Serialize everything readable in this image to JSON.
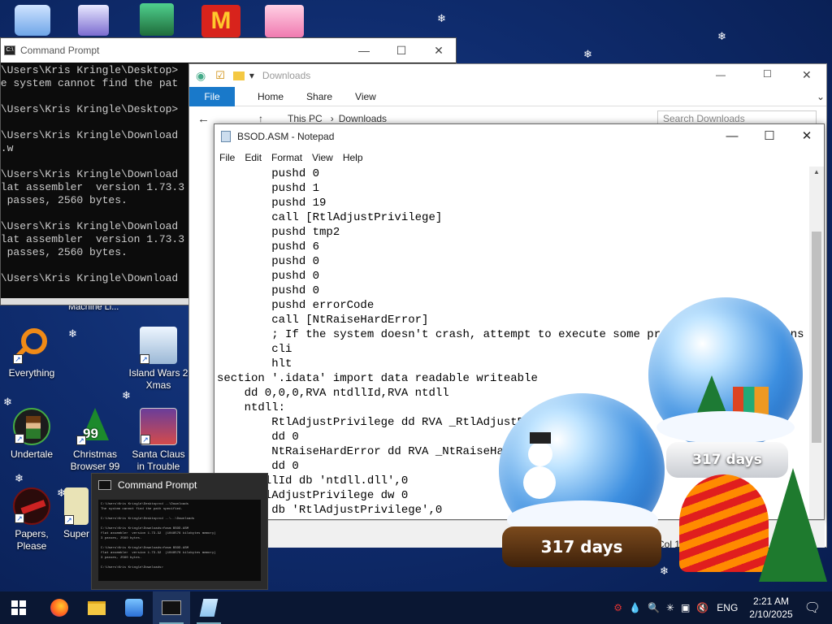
{
  "desktop": {
    "icons": [
      {
        "label": "Everything"
      },
      {
        "label": "Island Wars 2 Xmas"
      },
      {
        "label": "Undertale"
      },
      {
        "label": "Christmas Browser 99"
      },
      {
        "label": "Santa Claus in Trouble"
      },
      {
        "label": "Papers, Please"
      },
      {
        "label": "Super"
      },
      {
        "label": "Machine Li..."
      }
    ]
  },
  "cmd": {
    "title": "Command Prompt",
    "lines": ":\\Users\\Kris Kringle\\Desktop>\nhe system cannot find the pat\n\n:\\Users\\Kris Kringle\\Desktop>\n\n:\\Users\\Kris Kringle\\Download\n).w\n\n:\\Users\\Kris Kringle\\Download\nflat assembler  version 1.73.3\n3 passes, 2560 bytes.\n\n:\\Users\\Kris Kringle\\Download\nflat assembler  version 1.73.3\n3 passes, 2560 bytes.\n\n:\\Users\\Kris Kringle\\Download"
  },
  "explorer": {
    "title": "Downloads",
    "ribbon": {
      "file": "File",
      "home": "Home",
      "share": "Share",
      "view": "View"
    },
    "path": [
      "This PC",
      "Downloads"
    ],
    "search_placeholder": "Search Downloads"
  },
  "notepad": {
    "title": "BSOD.ASM - Notepad",
    "menu": {
      "file": "File",
      "edit": "Edit",
      "format": "Format",
      "view": "View",
      "help": "Help"
    },
    "content": "        pushd 0\n        pushd 1\n        pushd 19\n        call [RtlAdjustPrivilege]\n        pushd tmp2\n        pushd 6\n        pushd 0\n        pushd 0\n        pushd 0\n        pushd errorCode\n        call [NtRaiseHardError]\n        ; If the system doesn't crash, attempt to execute some privileged instructions to t\n        cli\n        hlt\nsection '.idata' import data readable writeable\n    dd 0,0,0,RVA ntdllId,RVA ntdll\n    ntdll:\n        RtlAdjustPrivilege dd RVA _RtlAdjustPrivilege\n        dd 0\n        NtRaiseHardError dd RVA _NtRaiseHardError\n        dd 0\n    ntdllId db 'ntdll.dll',0\n    _RtlAdjustPrivilege dw 0\n        db 'RtlAdjustPrivilege',0",
    "status_col": "Col 1"
  },
  "preview": {
    "title": "Command Prompt",
    "thumb_text": "C:\\Users\\Kris Kringle\\Desktop>cd ..\\Downloads\nThe system cannot find the path specified.\n\nC:\\Users\\Kris Kringle\\Desktop>cd ..\\..\\Downloads\n\nC:\\Users\\Kris Kringle\\Downloads>fasm BSOD.ASM\nflat assembler  version 1.73.32  (1048576 kilobytes memory)\n3 passes, 2560 bytes.\n\nC:\\Users\\Kris Kringle\\Downloads>fasm BSOD.ASM\nflat assembler  version 1.73.32  (1048576 kilobytes memory)\n3 passes, 2560 bytes.\n\nC:\\Users\\Kris Kringle\\Downloads>"
  },
  "globes": {
    "left_days": "317 days",
    "right_days": "317 days"
  },
  "taskbar": {
    "language": "ENG",
    "time": "2:21 AM",
    "date": "2/10/2025"
  }
}
